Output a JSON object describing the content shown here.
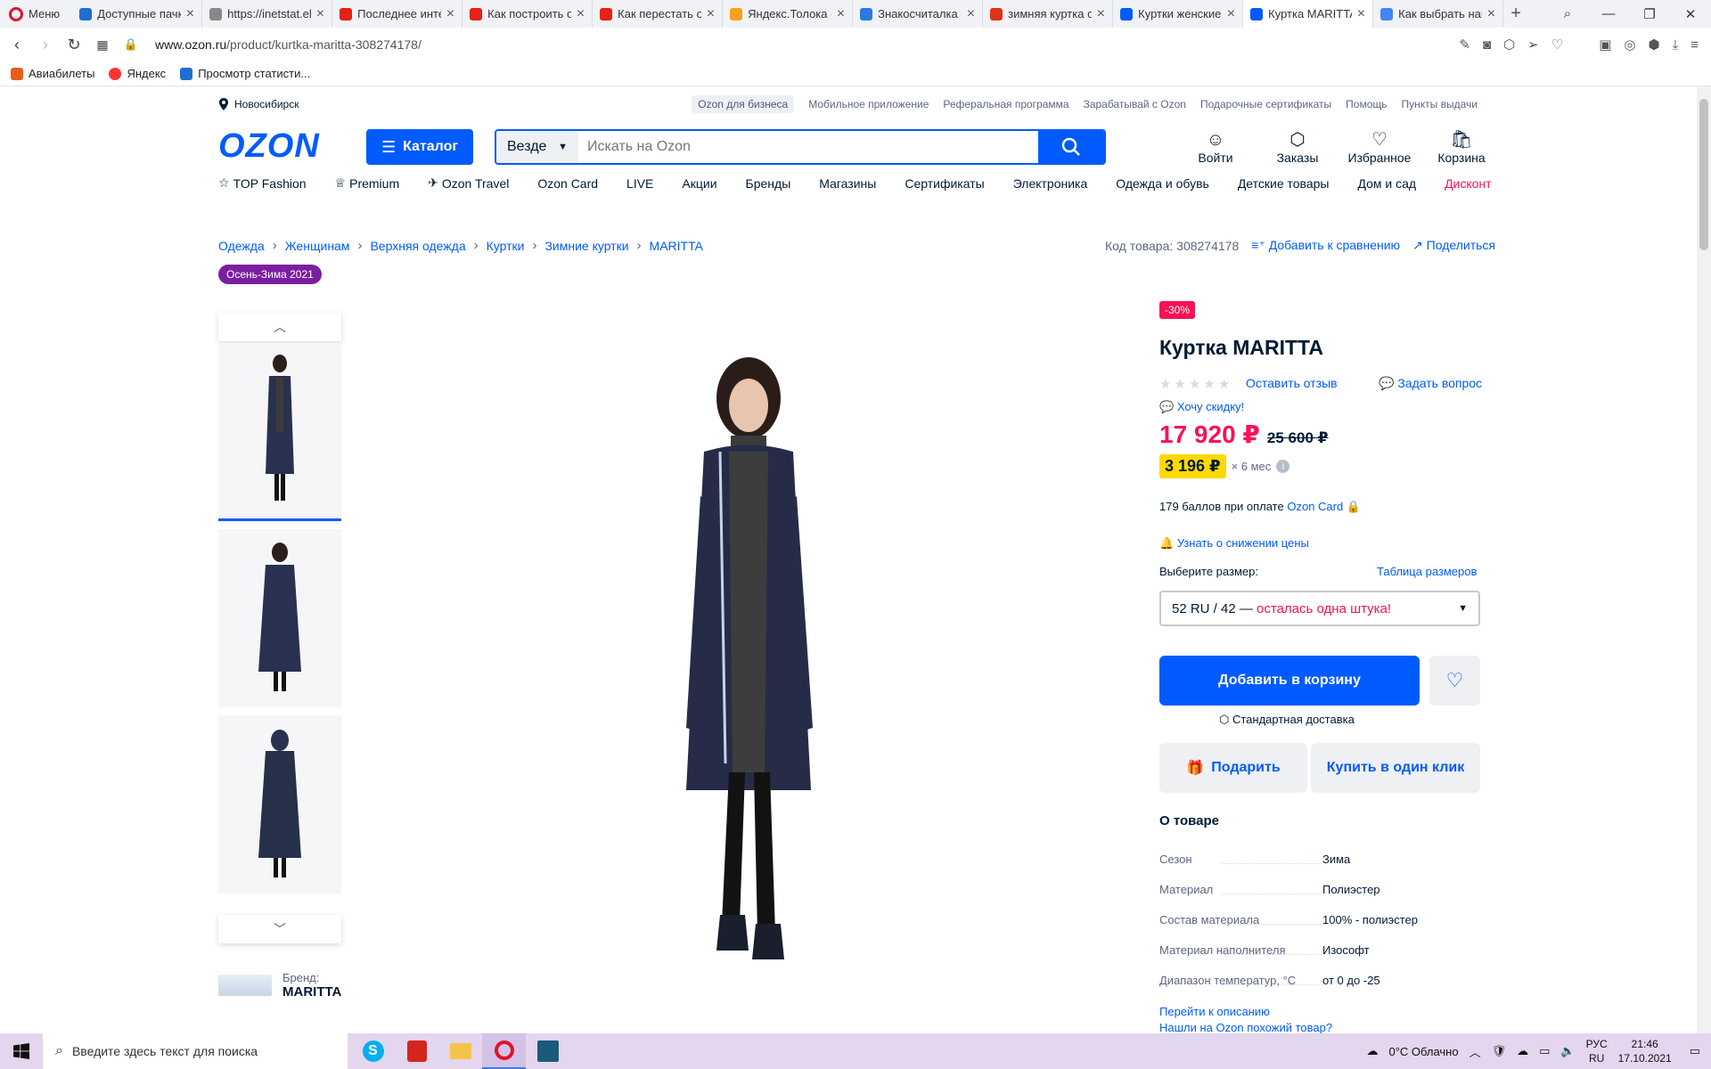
{
  "browser": {
    "menu_label": "Меню",
    "tabs": [
      {
        "title": "Доступные пачки",
        "color": "#1f6fd1"
      },
      {
        "title": "https://inetstat.el",
        "color": "#888888"
      },
      {
        "title": "Последнее интер",
        "color": "#e62117"
      },
      {
        "title": "Как построить от",
        "color": "#e62117"
      },
      {
        "title": "Как перестать от",
        "color": "#e62117"
      },
      {
        "title": "Яндекс.Толока -",
        "color": "#f7a21b"
      },
      {
        "title": "Знакосчиталка -",
        "color": "#2a7ae2"
      },
      {
        "title": "зимняя куртка о",
        "color": "#e0321a"
      },
      {
        "title": "Куртки женские",
        "color": "#005bff"
      },
      {
        "title": "Куртка MARITTA",
        "color": "#005bff"
      },
      {
        "title": "Как выбрать нап",
        "color": "#4285f4"
      }
    ],
    "url_domain": "www.ozon.ru",
    "url_path": "/product/kurtka-maritta-308274178/",
    "bookmarks": [
      "Авиабилеты",
      "Яндекс",
      "Просмотр статисти..."
    ]
  },
  "header": {
    "city": "Новосибирск",
    "top_links": [
      "Ozon для бизнеса",
      "Мобильное приложение",
      "Реферальная программа",
      "Зарабатывай с Ozon",
      "Подарочные сертификаты",
      "Помощь",
      "Пункты выдачи"
    ],
    "logo": "OZON",
    "catalog": "Каталог",
    "search_scope": "Везде",
    "search_placeholder": "Искать на Ozon",
    "user_nav": [
      "Войти",
      "Заказы",
      "Избранное",
      "Корзина"
    ],
    "menu": [
      "TOP Fashion",
      "Premium",
      "Ozon Travel",
      "Ozon Card",
      "LIVE",
      "Акции",
      "Бренды",
      "Магазины",
      "Сертификаты",
      "Электроника",
      "Одежда и обувь",
      "Детские товары",
      "Дом и сад",
      "Дисконт"
    ]
  },
  "breadcrumbs": [
    "Одежда",
    "Женщинам",
    "Верхняя одежда",
    "Куртки",
    "Зимние куртки",
    "MARITTA"
  ],
  "sku": {
    "code": "Код товара: 308274178",
    "compare": "Добавить к сравнению",
    "share": "Поделиться"
  },
  "season_badge": "Осень-Зима 2021",
  "brand": {
    "label": "Бренд:",
    "name": "MARITTA"
  },
  "product": {
    "discount": "-30%",
    "title": "Куртка MARITTA",
    "rating_stars": 0,
    "leave_review": "Оставить отзыв",
    "ask_question": "Задать вопрос",
    "want_discount": "Хочу скидку!",
    "price_now": "17 920 ₽",
    "price_old": "25 600 ₽",
    "installment": "3 196 ₽",
    "installment_term": "× 6 мес",
    "points_text": "179 баллов при оплате",
    "points_link": "Ozon Card",
    "notify_price": "Узнать о снижении цены",
    "size_label": "Выберите размер:",
    "size_table": "Таблица размеров",
    "size_value": "52 RU / 42 —",
    "size_warn": "осталась одна штука!",
    "add_to_cart": "Добавить в корзину",
    "delivery": "Стандартная доставка",
    "gift": "Подарить",
    "one_click": "Купить в один клик",
    "about_title": "О товаре",
    "specs": [
      {
        "k": "Сезон",
        "v": "Зима"
      },
      {
        "k": "Материал",
        "v": "Полиэстер"
      },
      {
        "k": "Состав материала",
        "v": "100% - полиэстер"
      },
      {
        "k": "Материал наполнителя",
        "v": "Изософт"
      },
      {
        "k": "Диапазон температур, °С",
        "v": "от 0 до -25"
      }
    ],
    "to_description": "Перейти к описанию",
    "similar": "Нашли на Ozon похожий товар?"
  },
  "taskbar": {
    "search_placeholder": "Введите здесь текст для поиска",
    "weather": "0°C Облачно",
    "lang_top": "РУС",
    "lang_bottom": "RU",
    "time": "21:46",
    "date": "17.10.2021"
  },
  "colors": {
    "accent": "#005bff",
    "sale": "#f91155",
    "installment": "#ffd800",
    "season": "#7b1fa2"
  }
}
